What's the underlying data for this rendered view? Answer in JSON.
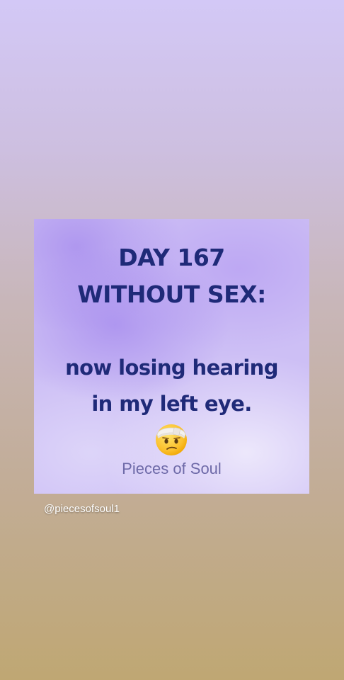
{
  "post": {
    "headline_line1": "DAY 167",
    "headline_line2": "WITHOUT SEX:",
    "body_line1": "now losing hearing",
    "body_line2": "in my left eye.",
    "emoji": "face-with-head-bandage",
    "brand": "Pieces of Soul"
  },
  "story": {
    "mention": "@piecesofsoul1"
  },
  "colors": {
    "text_navy": "#1f2a78",
    "brand_text": "#6e6aa8",
    "background_top": "#d3c8f6",
    "background_bottom": "#bfa773"
  }
}
